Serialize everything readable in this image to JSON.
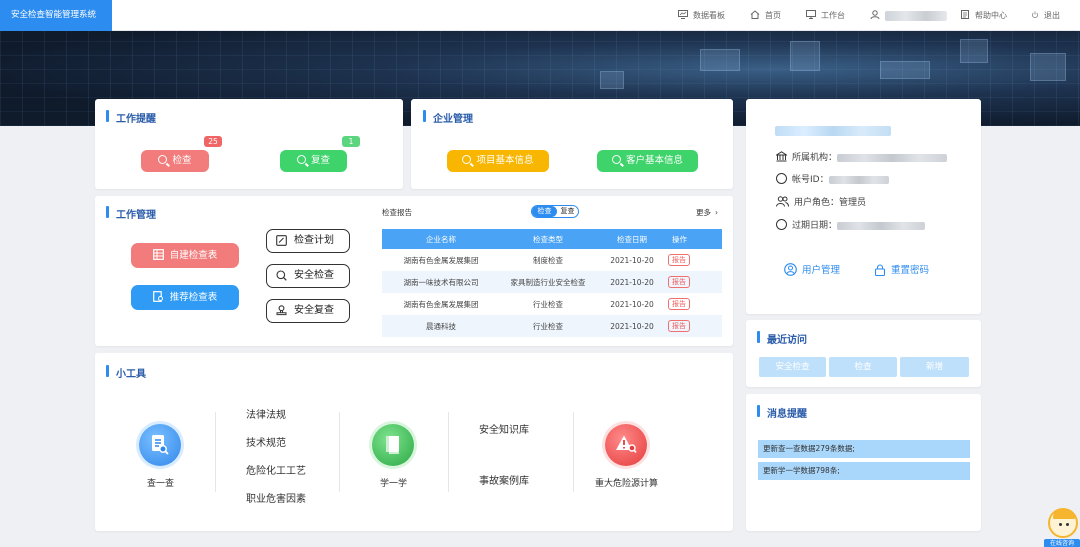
{
  "app": {
    "title": "安全检查智能管理系统"
  },
  "topnav": {
    "dashboard": "数据看板",
    "home": "首页",
    "workbench": "工作台",
    "help": "帮助中心",
    "logout": "退出"
  },
  "reminders": {
    "title": "工作提醒",
    "check_label": "检查",
    "check_count": "25",
    "recheck_label": "复查",
    "recheck_count": "1"
  },
  "enterprise": {
    "title": "企业管理",
    "project_info": "项目基本信息",
    "customer_info": "客户基本信息"
  },
  "work_mgmt": {
    "title": "工作管理",
    "self_build": "自建检查表",
    "recommend": "推荐检查表",
    "plan": "检查计划",
    "safety_check": "安全检查",
    "safety_recheck": "安全复查"
  },
  "report": {
    "title": "检查报告",
    "toggle_check": "检查",
    "toggle_recheck": "复查",
    "more": "更多",
    "columns": [
      "企业名称",
      "检查类型",
      "检查日期",
      "操作"
    ],
    "rows": [
      {
        "company": "湖南有色金属发展集团",
        "type": "制度检查",
        "date": "2021-10-20",
        "action": "报告"
      },
      {
        "company": "湖南一味技术有限公司",
        "type": "家具制造行业安全检查",
        "date": "2021-10-20",
        "action": "报告"
      },
      {
        "company": "湖南有色金属发展集团",
        "type": "行业检查",
        "date": "2021-10-20",
        "action": "报告"
      },
      {
        "company": "晨通科技",
        "type": "行业检查",
        "date": "2021-10-20",
        "action": "报告"
      }
    ]
  },
  "tools": {
    "title": "小工具",
    "lookup": "查一查",
    "laws": "法律法规",
    "tech": "技术规范",
    "chem": "危险化工工艺",
    "occupational": "职业危害因素",
    "learn": "学一学",
    "knowledge": "安全知识库",
    "accidents": "事故案例库",
    "hazard_calc": "重大危险源计算"
  },
  "profile": {
    "org_label": "所属机构：",
    "account_label": "帐号ID：",
    "role_label": "用户角色：",
    "role_value": "管理员",
    "expire_label": "过期日期：",
    "user_mgmt": "用户管理",
    "reset_pwd": "重置密码"
  },
  "recent": {
    "title": "最近访问",
    "items": [
      "安全检查",
      "检查",
      "新增"
    ]
  },
  "messages": {
    "title": "消息提醒",
    "items": [
      "更新查一查数据279条数据;",
      "更新学一学数据798条;"
    ]
  },
  "service": {
    "label": "在线咨询"
  },
  "colors": {
    "brand": "#2d8cf0",
    "red": "#f27c7c",
    "green": "#3fd36b",
    "yellow": "#f9b600",
    "blue": "#2f9bf5"
  }
}
